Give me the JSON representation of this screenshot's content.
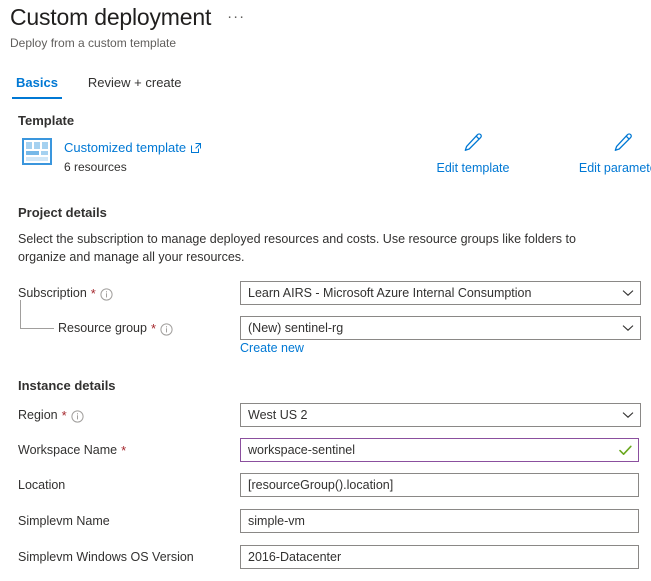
{
  "header": {
    "title": "Custom deployment",
    "subtitle": "Deploy from a custom template",
    "ellipsis": "···"
  },
  "tabs": [
    {
      "label": "Basics",
      "active": true
    },
    {
      "label": "Review + create",
      "active": false
    }
  ],
  "template_section": {
    "heading": "Template",
    "link_label": "Customized template",
    "resources_count": "6 resources",
    "actions": [
      {
        "label": "Edit template",
        "icon": "pencil-icon"
      },
      {
        "label": "Edit parameters",
        "icon": "pencil-icon"
      }
    ]
  },
  "project_details": {
    "heading": "Project details",
    "description": "Select the subscription to manage deployed resources and costs. Use resource groups like folders to organize and manage all your resources.",
    "subscription": {
      "label": "Subscription",
      "required": "*",
      "value": "Learn AIRS - Microsoft Azure Internal Consumption"
    },
    "resource_group": {
      "label": "Resource group",
      "required": "*",
      "value": "(New) sentinel-rg",
      "create_new_label": "Create new"
    }
  },
  "instance_details": {
    "heading": "Instance details",
    "fields": [
      {
        "label": "Region",
        "required": "*",
        "value": "West US 2"
      },
      {
        "label": "Workspace Name",
        "required": "*",
        "value": "workspace-sentinel"
      },
      {
        "label": "Location",
        "required": "",
        "value": "[resourceGroup().location]"
      },
      {
        "label": "Simplevm Name",
        "required": "",
        "value": "simple-vm"
      },
      {
        "label": "Simplevm Windows OS Version",
        "required": "",
        "value": "2016-Datacenter"
      }
    ]
  },
  "colors": {
    "accent": "#0078d4",
    "required_asterisk": "#a4262c",
    "focus_border": "#8b4f9e",
    "valid_check": "#6aa81f"
  }
}
